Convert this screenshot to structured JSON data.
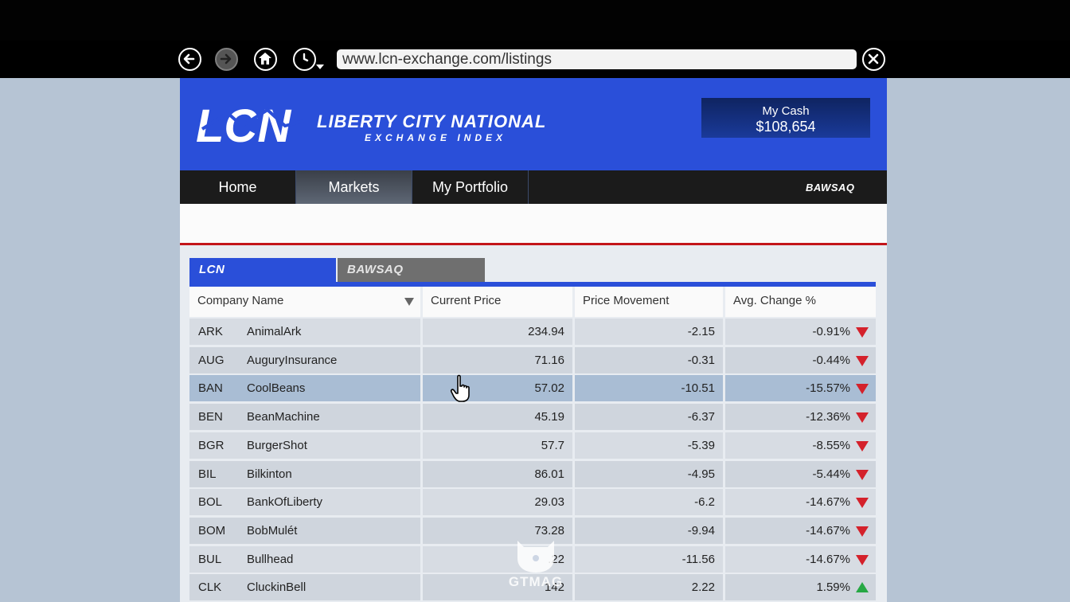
{
  "browser": {
    "url": "www.lcn-exchange.com/listings"
  },
  "header": {
    "logo_mark": "LCN",
    "brand_name": "LIBERTY CITY NATIONAL",
    "brand_sub": "EXCHANGE INDEX",
    "cash_label": "My Cash",
    "cash_value": "$108,654"
  },
  "nav": {
    "items": [
      {
        "label": "Home"
      },
      {
        "label": "Markets"
      },
      {
        "label": "My Portfolio"
      }
    ],
    "partner": "BAWSAQ"
  },
  "tabs": [
    {
      "label": "LCN"
    },
    {
      "label": "BAWSAQ"
    }
  ],
  "table": {
    "headers": [
      "Company Name",
      "Current Price",
      "Price Movement",
      "Avg. Change %"
    ],
    "rows": [
      {
        "symbol": "ARK",
        "name": "AnimalArk",
        "price": "234.94",
        "movement": "-2.15",
        "avg": "-0.91%",
        "dir": "down"
      },
      {
        "symbol": "AUG",
        "name": "AuguryInsurance",
        "price": "71.16",
        "movement": "-0.31",
        "avg": "-0.44%",
        "dir": "down"
      },
      {
        "symbol": "BAN",
        "name": "CoolBeans",
        "price": "57.02",
        "movement": "-10.51",
        "avg": "-15.57%",
        "dir": "down"
      },
      {
        "symbol": "BEN",
        "name": "BeanMachine",
        "price": "45.19",
        "movement": "-6.37",
        "avg": "-12.36%",
        "dir": "down"
      },
      {
        "symbol": "BGR",
        "name": "BurgerShot",
        "price": "57.7",
        "movement": "-5.39",
        "avg": "-8.55%",
        "dir": "down"
      },
      {
        "symbol": "BIL",
        "name": "Bilkinton",
        "price": "86.01",
        "movement": "-4.95",
        "avg": "-5.44%",
        "dir": "down"
      },
      {
        "symbol": "BOL",
        "name": "BankOfLiberty",
        "price": "29.03",
        "movement": "-6.2",
        "avg": "-14.67%",
        "dir": "down"
      },
      {
        "symbol": "BOM",
        "name": "BobMulét",
        "price": "73.28",
        "movement": "-9.94",
        "avg": "-14.67%",
        "dir": "down"
      },
      {
        "symbol": "BUL",
        "name": "Bullhead",
        "price": ".22",
        "movement": "-11.56",
        "avg": "-14.67%",
        "dir": "down"
      },
      {
        "symbol": "CLK",
        "name": "CluckinBell",
        "price": "142",
        "movement": "2.22",
        "avg": "1.59%",
        "dir": "up"
      }
    ]
  },
  "watermark": "GTMAG",
  "colors": {
    "header_blue": "#2a4fd9",
    "accent_red": "#c3151a",
    "down_arrow": "#d4212b",
    "up_arrow": "#27a844"
  }
}
